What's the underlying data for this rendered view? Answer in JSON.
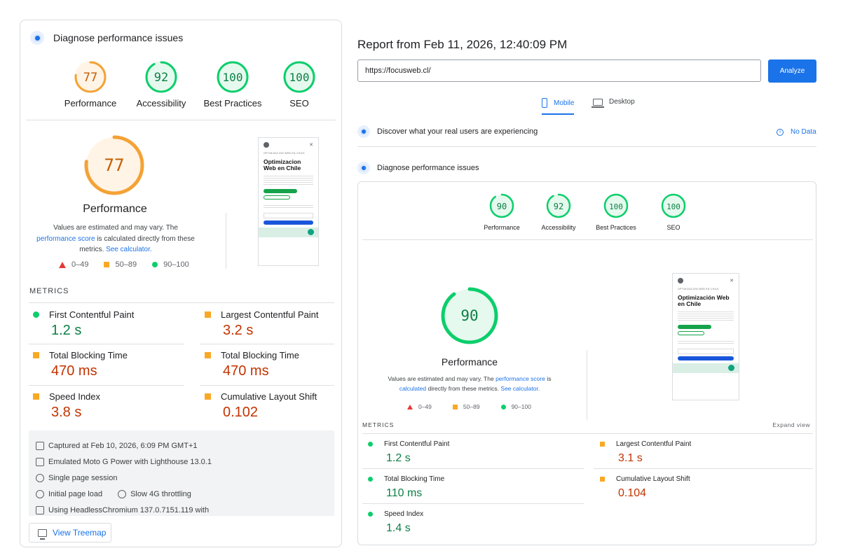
{
  "left": {
    "section_title": "Diagnose performance issues",
    "scores": [
      {
        "label": "Performance",
        "value": "77",
        "score": 77,
        "color": "#f4a236",
        "text_color": "#c45c00",
        "fill": "#fff4e5"
      },
      {
        "label": "Accessibility",
        "value": "92",
        "score": 92,
        "color": "#0cce6b",
        "text_color": "#0d7f45",
        "fill": "#e6f9ee"
      },
      {
        "label": "Best Practices",
        "value": "100",
        "score": 100,
        "color": "#0cce6b",
        "text_color": "#0d7f45",
        "fill": "#e6f9ee"
      },
      {
        "label": "SEO",
        "value": "100",
        "score": 100,
        "color": "#0cce6b",
        "text_color": "#0d7f45",
        "fill": "#e6f9ee"
      }
    ],
    "big_gauge": {
      "value": "77",
      "score": 77,
      "label": "Performance"
    },
    "note_part1": "Values are estimated and may vary. The",
    "note_link1": "performance score",
    "note_part2": "is calculated directly from these metrics.",
    "note_link2": "See calculator.",
    "legend": [
      "0–49",
      "50–89",
      "90–100"
    ],
    "metrics_title": "METRICS",
    "metrics": [
      {
        "name": "First Contentful Paint",
        "value": "1.2 s",
        "status": "good"
      },
      {
        "name": "Largest Contentful Paint",
        "value": "3.2 s",
        "status": "average"
      },
      {
        "name": "Total Blocking Time",
        "value": "470 ms",
        "status": "average"
      },
      {
        "name": "Total Blocking Time",
        "value": "470 ms",
        "status": "average"
      },
      {
        "name": "Speed Index",
        "value": "3.8 s",
        "status": "average"
      },
      {
        "name": "Cumulative Layout Shift",
        "value": "0.102",
        "status": "average"
      }
    ],
    "env": {
      "captured": "Captured at Feb 10, 2026, 6:09 PM GMT+1",
      "device": "Emulated Moto G Power with Lighthouse 13.0.1",
      "session": "Single page session",
      "load": "Initial page load",
      "throttle": "Slow 4G throttling",
      "browser": "Using HeadlessChromium 137.0.7151.119  with"
    },
    "treemap_label": "View Treemap"
  },
  "right": {
    "report_title": "Report from Feb 11, 2026, 12:40:09 PM",
    "url_value": "https://focusweb.cl/",
    "analyze_label": "Analyze",
    "tabs": {
      "mobile": "Mobile",
      "desktop": "Desktop"
    },
    "discover_title": "Discover what your real users are experiencing",
    "no_data": "No Data",
    "section_title": "Diagnose performance issues",
    "scores": [
      {
        "label": "Performance",
        "value": "90",
        "score": 90
      },
      {
        "label": "Accessibility",
        "value": "92",
        "score": 92
      },
      {
        "label": "Best Practices",
        "value": "100",
        "score": 100
      },
      {
        "label": "SEO",
        "value": "100",
        "score": 100
      }
    ],
    "big_gauge": {
      "value": "90",
      "score": 90,
      "label": "Performance"
    },
    "note_part1": "Values are estimated and may vary. The",
    "note_link1": "performance score",
    "note_part1b": "is",
    "note_link1b": "calculated",
    "note_part2": "directly from these metrics.",
    "note_link2": "See calculator.",
    "legend": [
      "0–49",
      "50–89",
      "90–100"
    ],
    "metrics_title": "METRICS",
    "expand_view": "Expand view",
    "metrics": [
      {
        "name": "First Contentful Paint",
        "value": "1.2 s",
        "status": "good"
      },
      {
        "name": "Largest Contentful Paint",
        "value": "3.1 s",
        "status": "average"
      },
      {
        "name": "Total Blocking Time",
        "value": "110 ms",
        "status": "good"
      },
      {
        "name": "Cumulative Layout Shift",
        "value": "0.104",
        "status": "average"
      },
      {
        "name": "Speed Index",
        "value": "1.4 s",
        "status": "good"
      }
    ]
  },
  "thumbnail": {
    "kicker": "OPTIMIZACION WEB EN CHILE",
    "title_left": "Optimizacion Web en Chile",
    "title_right": "Optimización Web en Chile"
  },
  "colors": {
    "good": "#0cce6b",
    "average": "#f9a825",
    "poor": "#e53935",
    "accent": "#1a73e8"
  }
}
